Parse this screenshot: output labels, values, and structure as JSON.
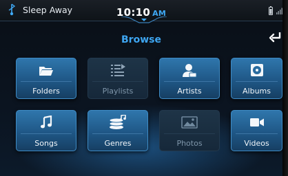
{
  "status_bar": {
    "now_playing": "Sleep Away",
    "time": "10:10",
    "ampm": "AM"
  },
  "header": {
    "title": "Browse"
  },
  "tiles": [
    {
      "label": "Folders",
      "icon": "folder-icon",
      "enabled": true
    },
    {
      "label": "Playlists",
      "icon": "playlist-icon",
      "enabled": false
    },
    {
      "label": "Artists",
      "icon": "artist-icon",
      "enabled": true
    },
    {
      "label": "Albums",
      "icon": "album-icon",
      "enabled": true
    },
    {
      "label": "Songs",
      "icon": "music-note-icon",
      "enabled": true
    },
    {
      "label": "Genres",
      "icon": "genres-icon",
      "enabled": true
    },
    {
      "label": "Photos",
      "icon": "photo-icon",
      "enabled": false
    },
    {
      "label": "Videos",
      "icon": "video-camera-icon",
      "enabled": true
    }
  ],
  "colors": {
    "accent": "#3ea6f2",
    "tile_active": "#2a6ca0",
    "tile_disabled": "#1b2f42"
  }
}
